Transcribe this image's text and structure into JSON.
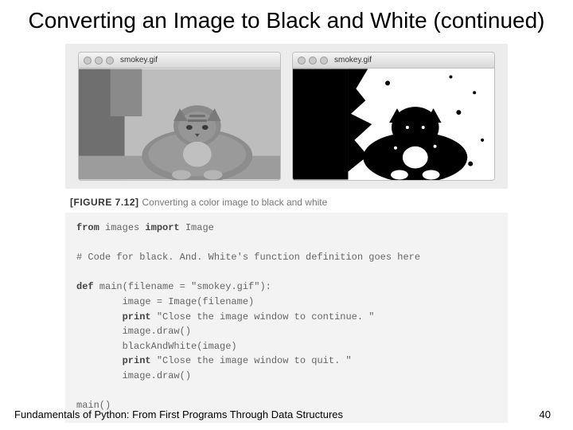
{
  "title": "Converting an Image to Black and White (continued)",
  "images": {
    "left": {
      "filename": "smokey.gif"
    },
    "right": {
      "filename": "smokey.gif"
    }
  },
  "figure": {
    "label": "[FIGURE 7.12]",
    "caption": "Converting a color image to black and white"
  },
  "code": {
    "kw_from": "from",
    "mod": " images ",
    "kw_import": "import",
    "cls": " Image",
    "comment": "# Code for black. And. White's function definition goes here",
    "kw_def": "def",
    "def_sig": " main(filename = \"smokey.gif\"):",
    "l1": "        image = Image(filename)",
    "l2a": "        ",
    "kw_print1": "print",
    "l2b": " \"Close the image window to continue. \"",
    "l3": "        image.draw()",
    "l4": "        blackAndWhite(image)",
    "l5a": "        ",
    "kw_print2": "print",
    "l5b": " \"Close the image window to quit. \"",
    "l6": "        image.draw()",
    "call": "main()"
  },
  "footer": {
    "book": "Fundamentals of Python: From First Programs Through Data Structures",
    "page": "40"
  }
}
